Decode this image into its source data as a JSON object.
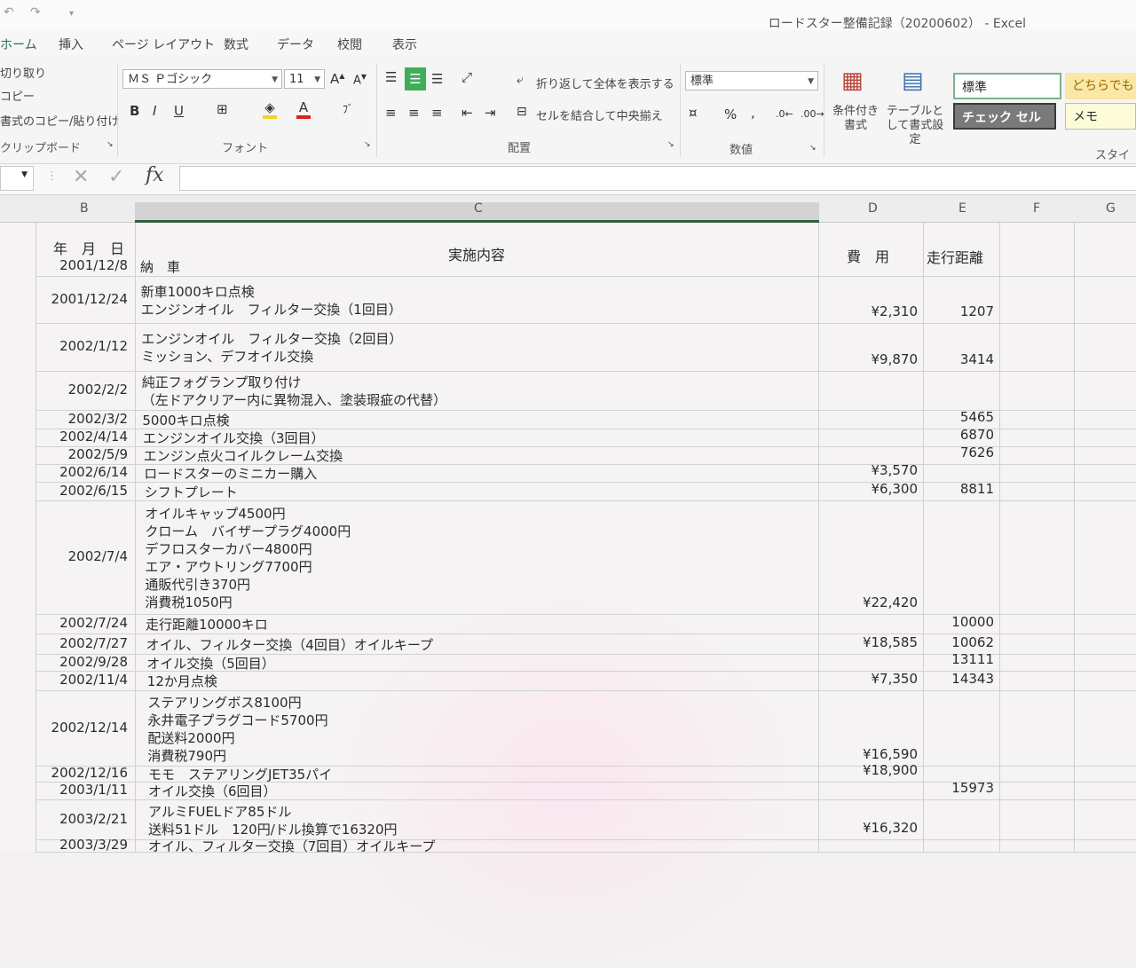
{
  "window": {
    "title": "ロードスター整備記録（20200602） - Excel"
  },
  "tabs": [
    "ホーム",
    "挿入",
    "ページ レイアウト",
    "数式",
    "データ",
    "校閲",
    "表示"
  ],
  "clipboard": {
    "cut": "切り取り",
    "copy": "コピー",
    "format_painter": "書式のコピー/貼り付け",
    "group": "クリップボード"
  },
  "font": {
    "name": "ＭＳ Ｐゴシック",
    "size": "11",
    "group": "フォント",
    "bold": "B",
    "italic": "I",
    "underline": "U",
    "fill_color": "#f2d12e",
    "font_color": "#e02020"
  },
  "alignment": {
    "wrap": "折り返して全体を表示する",
    "merge": "セルを結合して中央揃え",
    "group": "配置"
  },
  "number": {
    "format": "標準",
    "group": "数値",
    "percent": "%",
    "comma": ","
  },
  "styles": {
    "conditional": "条件付き書式",
    "table": "テーブルとして書式設定",
    "normal": "標準",
    "neutral": "どちらでも",
    "check": "チェック セル",
    "memo": "メモ",
    "group": "スタイル"
  },
  "formula": {
    "name_box": "",
    "fx": "fx",
    "value": ""
  },
  "columns": [
    "B",
    "C",
    "D",
    "E",
    "F",
    "G"
  ],
  "headers": {
    "date": "年　月　日",
    "content": "実施内容",
    "cost": "費　用",
    "distance": "走行距離"
  },
  "rows": [
    {
      "date": "2001/12/8",
      "content": [
        "納　車"
      ],
      "cost": "",
      "dist": ""
    },
    {
      "date": "2001/12/24",
      "content": [
        "新車1000キロ点検",
        "エンジンオイル　フィルター交換（1回目）"
      ],
      "cost": "¥2,310",
      "dist": "1207"
    },
    {
      "date": "2002/1/12",
      "content": [
        "エンジンオイル　フィルター交換（2回目）",
        "ミッション、デフオイル交換"
      ],
      "cost": "¥9,870",
      "dist": "3414"
    },
    {
      "date": "2002/2/2",
      "content": [
        "純正フォグランプ取り付け",
        "（左ドアクリアー内に異物混入、塗装瑕疵の代替）"
      ],
      "cost": "",
      "dist": ""
    },
    {
      "date": "2002/3/2",
      "content": [
        "5000キロ点検"
      ],
      "cost": "",
      "dist": "5465"
    },
    {
      "date": "2002/4/14",
      "content": [
        "エンジンオイル交換（3回目）"
      ],
      "cost": "",
      "dist": "6870"
    },
    {
      "date": "2002/5/9",
      "content": [
        "エンジン点火コイルクレーム交換"
      ],
      "cost": "",
      "dist": "7626"
    },
    {
      "date": "2002/6/14",
      "content": [
        "ロードスターのミニカー購入"
      ],
      "cost": "¥3,570",
      "dist": ""
    },
    {
      "date": "2002/6/15",
      "content": [
        "シフトプレート"
      ],
      "cost": "¥6,300",
      "dist": "8811"
    },
    {
      "date": "2002/7/4",
      "content": [
        "オイルキャップ4500円",
        "クローム　バイザープラグ4000円",
        "デフロスターカバー4800円",
        "エア・アウトリング7700円",
        "通販代引き370円",
        "消費税1050円"
      ],
      "cost": "¥22,420",
      "dist": ""
    },
    {
      "date": "2002/7/24",
      "content": [
        "走行距離10000キロ"
      ],
      "cost": "",
      "dist": "10000"
    },
    {
      "date": "2002/7/27",
      "content": [
        "オイル、フィルター交換（4回目）オイルキープ"
      ],
      "cost": "¥18,585",
      "dist": "10062"
    },
    {
      "date": "2002/9/28",
      "content": [
        "オイル交換（5回目）"
      ],
      "cost": "",
      "dist": "13111"
    },
    {
      "date": "2002/11/4",
      "content": [
        "12か月点検"
      ],
      "cost": "¥7,350",
      "dist": "14343"
    },
    {
      "date": "2002/12/14",
      "content": [
        "ステアリングボス8100円",
        "永井電子プラグコード5700円",
        "配送料2000円",
        "消費税790円"
      ],
      "cost": "¥16,590",
      "dist": ""
    },
    {
      "date": "2002/12/16",
      "content": [
        "モモ　ステアリングJET35パイ"
      ],
      "cost": "¥18,900",
      "dist": ""
    },
    {
      "date": "2003/1/11",
      "content": [
        "オイル交換（6回目）"
      ],
      "cost": "",
      "dist": "15973"
    },
    {
      "date": "2003/2/21",
      "content": [
        "アルミFUELドア85ドル",
        "送料51ドル　120円/ドル換算で16320円"
      ],
      "cost": "¥16,320",
      "dist": ""
    },
    {
      "date": "2003/3/29",
      "content": [
        "オイル、フィルター交換（7回目）オイルキープ"
      ],
      "cost": "",
      "dist": ""
    }
  ]
}
